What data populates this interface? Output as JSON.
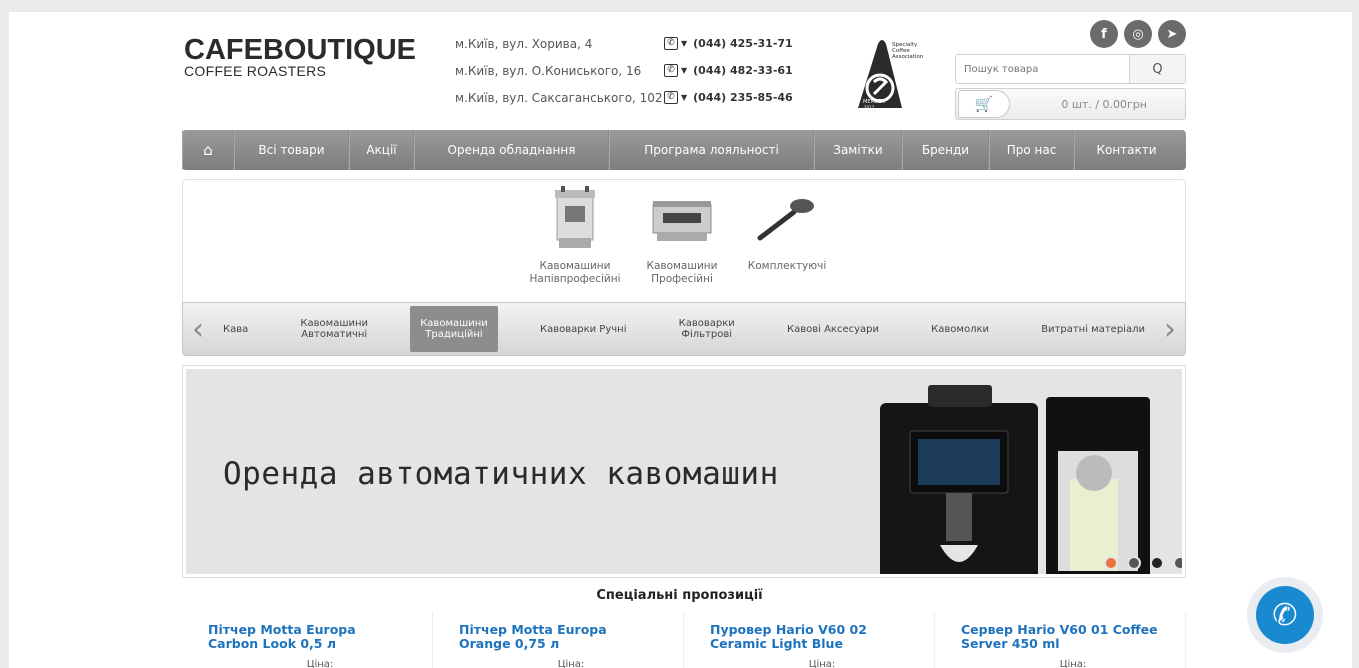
{
  "header": {
    "logo_main": "CAFEBOUTIQUE",
    "logo_sub": "COFFEE ROASTERS",
    "addresses": [
      "м.Київ, вул. Хорива, 4",
      "м.Київ, вул. О.Кониського, 16",
      "м.Київ, вул. Саксаганського, 102"
    ],
    "phones": [
      "(044) 425-31-71",
      "(044) 482-33-61",
      "(044) 235-85-46"
    ],
    "badge": {
      "lines": [
        "Specialty",
        "Coffee",
        "Association"
      ],
      "member": "MEMBER",
      "year": "2017"
    },
    "social": [
      "facebook-icon",
      "instagram-icon",
      "telegram-icon"
    ],
    "search_placeholder": "Пошук товара",
    "search_button": "Q",
    "cart_text": "0 шт. / 0.00грн"
  },
  "nav": {
    "items": [
      "Всі товари",
      "Акції",
      "Оренда обладнання",
      "Програма лояльності",
      "Замітки",
      "Бренди",
      "Про нас",
      "Контакти"
    ]
  },
  "categories": [
    {
      "label": "Кавомашини Напівпрофесійні"
    },
    {
      "label": "Кавомашини Професійні"
    },
    {
      "label": "Комплектуючі"
    }
  ],
  "category_bar": {
    "items": [
      "Кава",
      "Кавомашини\nАвтоматичні",
      "Кавомашини\nТрадиційні",
      "Кавоварки Ручні",
      "Кавоварки\nФільтрові",
      "Кавові Аксесуари",
      "Кавомолки",
      "Витратні матеріали"
    ],
    "active_index": 2
  },
  "banner": {
    "title": "Оренда автоматичних кавомашин",
    "dot_colors": [
      "#e8743b",
      "#555555",
      "#222222",
      "#555555"
    ]
  },
  "offers": {
    "title": "Спеціальні пропозиції",
    "items": [
      {
        "name": "Пітчер Motta Europa Carbon Look 0,5 л",
        "price_label": "Ціна:"
      },
      {
        "name": "Пітчер Motta Europa Orange 0,75 л",
        "price_label": "Ціна:"
      },
      {
        "name": "Пуровер Hario V60 02 Ceramic Light Blue",
        "price_label": "Ціна:"
      },
      {
        "name": "Сервер Hario V60 01 Coffee Server 450 ml",
        "price_label": "Ціна:"
      }
    ]
  }
}
